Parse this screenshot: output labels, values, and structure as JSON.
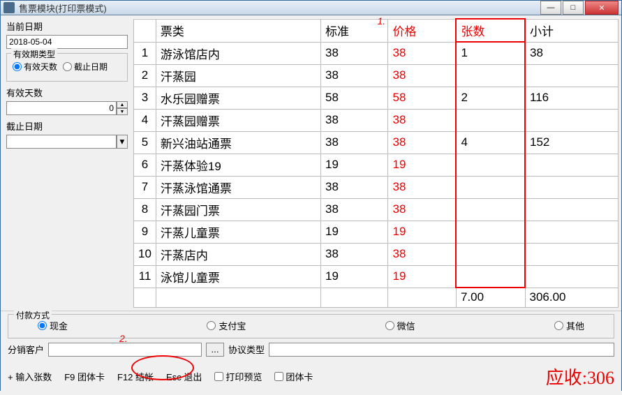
{
  "window": {
    "title": "售票模块(打印票模式)"
  },
  "left": {
    "current_date_label": "当前日期",
    "current_date_value": "2018-05-04",
    "validity_legend": "有效期类型",
    "validity_days_label": "有效天数",
    "validity_deadline_label": "截止日期",
    "valid_days_label": "有效天数",
    "valid_days_value": "0",
    "deadline_label": "截止日期",
    "deadline_value": ""
  },
  "table": {
    "headers": {
      "type": "票类",
      "standard": "标准",
      "price": "价格",
      "qty": "张数",
      "subtotal": "小计"
    },
    "rows": [
      {
        "n": "1",
        "type": "游泳馆店内",
        "std": "38",
        "price": "38",
        "qty": "1",
        "sub": "38"
      },
      {
        "n": "2",
        "type": "汗蒸园",
        "std": "38",
        "price": "38",
        "qty": "",
        "sub": ""
      },
      {
        "n": "3",
        "type": "水乐园赠票",
        "std": "58",
        "price": "58",
        "qty": "2",
        "sub": "116"
      },
      {
        "n": "4",
        "type": "汗蒸园赠票",
        "std": "38",
        "price": "38",
        "qty": "",
        "sub": ""
      },
      {
        "n": "5",
        "type": "新兴油站通票",
        "std": "38",
        "price": "38",
        "qty": "4",
        "sub": "152"
      },
      {
        "n": "6",
        "type": "汗蒸体验19",
        "std": "19",
        "price": "19",
        "qty": "",
        "sub": ""
      },
      {
        "n": "7",
        "type": "汗蒸泳馆通票",
        "std": "38",
        "price": "38",
        "qty": "",
        "sub": ""
      },
      {
        "n": "8",
        "type": "汗蒸园门票",
        "std": "38",
        "price": "38",
        "qty": "",
        "sub": ""
      },
      {
        "n": "9",
        "type": "汗蒸儿童票",
        "std": "19",
        "price": "19",
        "qty": "",
        "sub": ""
      },
      {
        "n": "10",
        "type": "汗蒸店内",
        "std": "38",
        "price": "38",
        "qty": "",
        "sub": ""
      },
      {
        "n": "11",
        "type": "泳馆儿童票",
        "std": "19",
        "price": "19",
        "qty": "",
        "sub": ""
      }
    ],
    "foot_qty": "7.00",
    "foot_sub": "306.00"
  },
  "payment": {
    "legend": "付款方式",
    "cash": "现金",
    "alipay": "支付宝",
    "wechat": "微信",
    "other": "其他"
  },
  "customer": {
    "label": "分销客户",
    "value": "",
    "proto_label": "协议类型",
    "proto_value": ""
  },
  "shortcuts": {
    "input_qty": "+ 输入张数",
    "group": "F9 团体卡",
    "checkout": "F12  结帐",
    "exit": "Esc 退出",
    "preview": "打印预览",
    "group_card": "团体卡"
  },
  "due": {
    "label": "应收:",
    "amount": "306"
  },
  "annot": {
    "n1": "1.",
    "n2": "2."
  }
}
